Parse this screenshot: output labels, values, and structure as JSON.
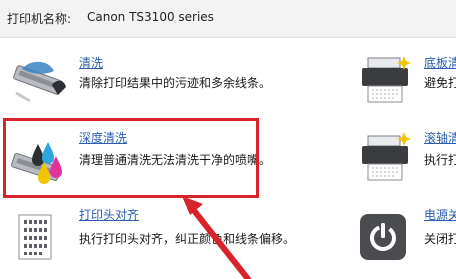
{
  "printer": {
    "name_label": "打印机名称:",
    "name_value": "Canon TS3100 series"
  },
  "left_items": [
    {
      "icon": "cleaning-icon",
      "title": "清洗",
      "desc": "清除打印结果中的污迹和多余线条。"
    },
    {
      "icon": "deep-cleaning-icon",
      "title": "深度清洗",
      "desc": "清理普通清洗无法清洗干净的喷嘴。"
    },
    {
      "icon": "print-head-alignment-icon",
      "title": "打印头对齐",
      "desc": "执行打印头对齐，纠正颜色和线条偏移。"
    }
  ],
  "right_items": [
    {
      "icon": "bottom-plate-cleaning-icon",
      "title": "底板清",
      "desc": "避免打"
    },
    {
      "icon": "roller-cleaning-icon",
      "title": "滚轴清",
      "desc": "执行打"
    },
    {
      "icon": "power-settings-icon",
      "title": "电源关",
      "desc": "关闭打"
    }
  ],
  "colors": {
    "link": "#2a5db0",
    "highlight": "#d8232a"
  }
}
